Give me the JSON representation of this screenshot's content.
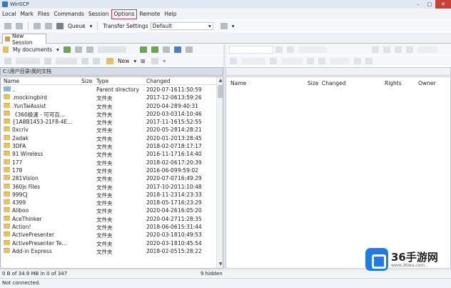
{
  "window": {
    "title": "WinSCP"
  },
  "menu": [
    "Local",
    "Mark",
    "Files",
    "Commands",
    "Session",
    "Options",
    "Remote",
    "Help"
  ],
  "toolbar": {
    "queue_label": "Queue",
    "transfer_settings_label": "Transfer Settings",
    "transfer_settings_value": "Default"
  },
  "tabs": [
    {
      "label": "New Session"
    }
  ],
  "local": {
    "location_label": "My documents",
    "new_label": "New",
    "path": "C:\\用户目录\\我的文档",
    "columns": {
      "name": "Name",
      "size": "Size",
      "type": "Type",
      "changed": "Changed"
    },
    "rows": [
      {
        "name": "..",
        "type": "Parent directory",
        "date": "2020-07-16",
        "time": "11:50:59",
        "kind": "up"
      },
      {
        "name": ".mockingbird",
        "type": "文件夹",
        "date": "2017-12-06",
        "time": "13:59:26",
        "kind": "folder"
      },
      {
        "name": ".YunTaiAssist",
        "type": "文件夹",
        "date": "2020-04-28",
        "time": "9:40:31",
        "kind": "folder"
      },
      {
        "name": "《360极速 - 可可百...",
        "type": "文件夹",
        "date": "2020-03-03",
        "time": "14:10:46",
        "kind": "folder"
      },
      {
        "name": "{1A8B1453-21F8-4E...",
        "type": "文件夹",
        "date": "2017-11-16",
        "time": "15:52:55",
        "kind": "folder"
      },
      {
        "name": "0xcriv",
        "type": "文件夹",
        "date": "2020-05-28",
        "time": "14:28:21",
        "kind": "folder"
      },
      {
        "name": "2adak",
        "type": "文件夹",
        "date": "2020-01-20",
        "time": "13:28:45",
        "kind": "folder"
      },
      {
        "name": "3DFA",
        "type": "文件夹",
        "date": "2018-02-07",
        "time": "18:17:17",
        "kind": "folder"
      },
      {
        "name": "91 Wireless",
        "type": "文件夹",
        "date": "2016-11-17",
        "time": "16:14:40",
        "kind": "folder"
      },
      {
        "name": "177",
        "type": "文件夹",
        "date": "2018-02-06",
        "time": "17:20:39",
        "kind": "folder"
      },
      {
        "name": "178",
        "type": "文件夹",
        "date": "2016-06-09",
        "time": "9:59:02",
        "kind": "folder"
      },
      {
        "name": "281Vision",
        "type": "文件夹",
        "date": "2020-07-07",
        "time": "16:49:29",
        "kind": "folder"
      },
      {
        "name": "360js Files",
        "type": "文件夹",
        "date": "2017-10-20",
        "time": "11:10:48",
        "kind": "folder"
      },
      {
        "name": "999CJ",
        "type": "文件夹",
        "date": "2018-11-23",
        "time": "14:23:33",
        "kind": "folder"
      },
      {
        "name": "4399",
        "type": "文件夹",
        "date": "2018-05-17",
        "time": "16:23:29",
        "kind": "folder"
      },
      {
        "name": "Aliboo",
        "type": "文件夹",
        "date": "2020-04-26",
        "time": "16:05:20",
        "kind": "folder"
      },
      {
        "name": "AceThinker",
        "type": "文件夹",
        "date": "2020-04-27",
        "time": "11:28:35",
        "kind": "folder"
      },
      {
        "name": "Action!",
        "type": "文件夹",
        "date": "2018-06-06",
        "time": "15:31:44",
        "kind": "folder"
      },
      {
        "name": "ActivePresenter",
        "type": "文件夹",
        "date": "2020-03-18",
        "time": "10:49:53",
        "kind": "folder"
      },
      {
        "name": "ActivePresenter Te...",
        "type": "文件夹",
        "date": "2020-03-18",
        "time": "10:45:54",
        "kind": "folder"
      },
      {
        "name": "Add-in Express",
        "type": "文件夹",
        "date": "2018-02-05",
        "time": "15:28:22",
        "kind": "folder"
      }
    ]
  },
  "remote": {
    "columns": {
      "name": "Name",
      "size": "Size",
      "changed": "Changed",
      "rights": "Rights",
      "owner": "Owner"
    }
  },
  "status": {
    "selection": "0 B of 34.9 MB in 0 of 347",
    "hidden": "9 hidden",
    "connection": "Not connected."
  },
  "watermark": {
    "brand": "36手游网",
    "url": "www.36wu.com"
  }
}
